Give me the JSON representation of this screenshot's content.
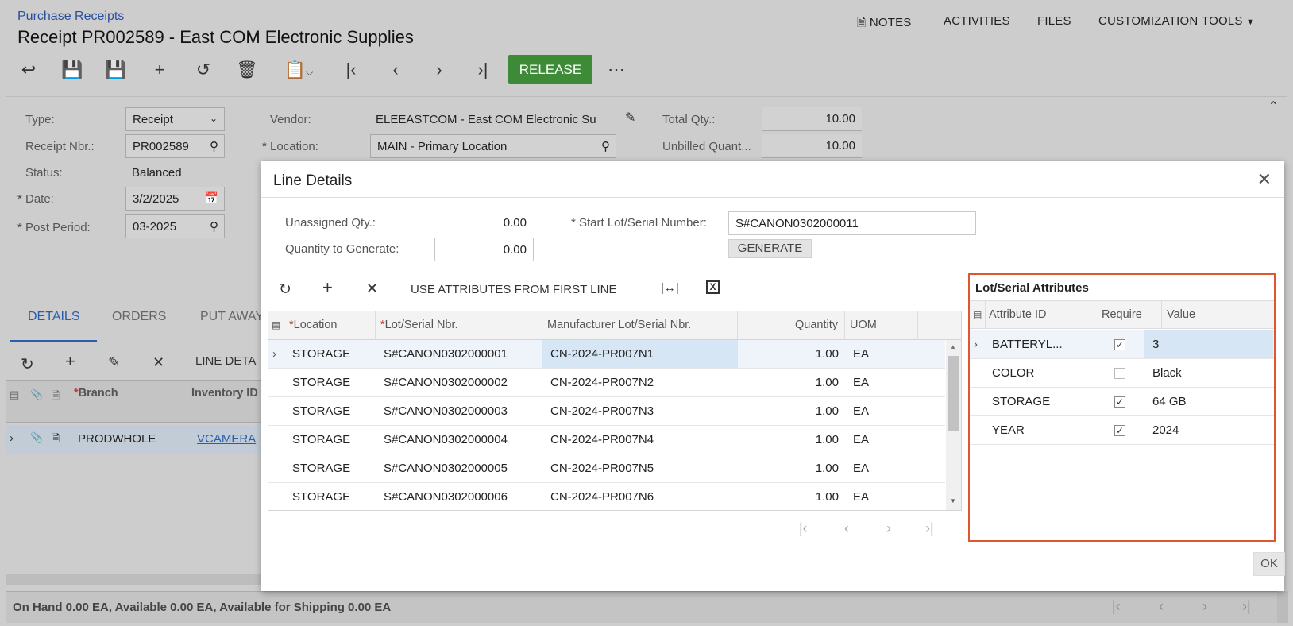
{
  "header": {
    "breadcrumb": "Purchase Receipts",
    "title": "Receipt PR002589 - East COM Electronic Supplies",
    "nav": [
      "NOTES",
      "ACTIVITIES",
      "FILES",
      "CUSTOMIZATION",
      "TOOLS"
    ],
    "release_label": "RELEASE"
  },
  "form": {
    "type_label": "Type:",
    "type_value": "Receipt",
    "receipt_nbr_label": "Receipt Nbr.:",
    "receipt_nbr_value": "PR002589",
    "status_label": "Status:",
    "status_value": "Balanced",
    "date_label": "Date:",
    "date_value": "3/2/2025",
    "post_period_label": "Post Period:",
    "post_period_value": "03-2025",
    "vendor_label": "Vendor:",
    "vendor_value": "ELEEASTCOM - East COM Electronic Su",
    "location_label": "Location:",
    "location_value": "MAIN - Primary Location",
    "total_qty_label": "Total Qty.:",
    "total_qty_value": "10.00",
    "unbilled_label": "Unbilled Quant...",
    "unbilled_value": "10.00"
  },
  "tabs": [
    "DETAILS",
    "ORDERS",
    "PUT AWAY"
  ],
  "details_grid": {
    "toolbar_label": "LINE DETA",
    "columns": [
      "Branch",
      "Inventory ID"
    ],
    "row": {
      "branch": "PRODWHOLE",
      "inventory": "VCAMERA"
    }
  },
  "status_bar": "On Hand 0.00 EA, Available 0.00 EA, Available for Shipping 0.00 EA",
  "dialog": {
    "title": "Line Details",
    "unassigned_label": "Unassigned Qty.:",
    "unassigned_value": "0.00",
    "qty_generate_label": "Quantity to Generate:",
    "qty_generate_value": "0.00",
    "start_lot_label": "Start Lot/Serial Number:",
    "start_lot_value": "S#CANON0302000011",
    "generate_label": "GENERATE",
    "use_attrs_label": "USE ATTRIBUTES FROM FIRST LINE",
    "columns": [
      "Location",
      "Lot/Serial Nbr.",
      "Manufacturer Lot/Serial Nbr.",
      "Quantity",
      "UOM"
    ],
    "rows": [
      {
        "location": "STORAGE",
        "lot": "S#CANON0302000001",
        "mfr": "CN-2024-PR007N1",
        "qty": "1.00",
        "uom": "EA"
      },
      {
        "location": "STORAGE",
        "lot": "S#CANON0302000002",
        "mfr": "CN-2024-PR007N2",
        "qty": "1.00",
        "uom": "EA"
      },
      {
        "location": "STORAGE",
        "lot": "S#CANON0302000003",
        "mfr": "CN-2024-PR007N3",
        "qty": "1.00",
        "uom": "EA"
      },
      {
        "location": "STORAGE",
        "lot": "S#CANON0302000004",
        "mfr": "CN-2024-PR007N4",
        "qty": "1.00",
        "uom": "EA"
      },
      {
        "location": "STORAGE",
        "lot": "S#CANON0302000005",
        "mfr": "CN-2024-PR007N5",
        "qty": "1.00",
        "uom": "EA"
      },
      {
        "location": "STORAGE",
        "lot": "S#CANON0302000006",
        "mfr": "CN-2024-PR007N6",
        "qty": "1.00",
        "uom": "EA"
      }
    ],
    "attributes": {
      "title": "Lot/Serial Attributes",
      "columns": [
        "Attribute ID",
        "Require",
        "Value"
      ],
      "rows": [
        {
          "id": "BATTERYL...",
          "required": true,
          "value": "3"
        },
        {
          "id": "COLOR",
          "required": false,
          "value": "Black"
        },
        {
          "id": "STORAGE",
          "required": true,
          "value": "64 GB"
        },
        {
          "id": "YEAR",
          "required": true,
          "value": "2024"
        }
      ]
    },
    "ok_label": "OK"
  },
  "colors": {
    "release_green": "#3d8b37",
    "link_blue": "#2a5db0",
    "highlight_border": "#e0562e",
    "selected_row": "#dde9f5"
  }
}
